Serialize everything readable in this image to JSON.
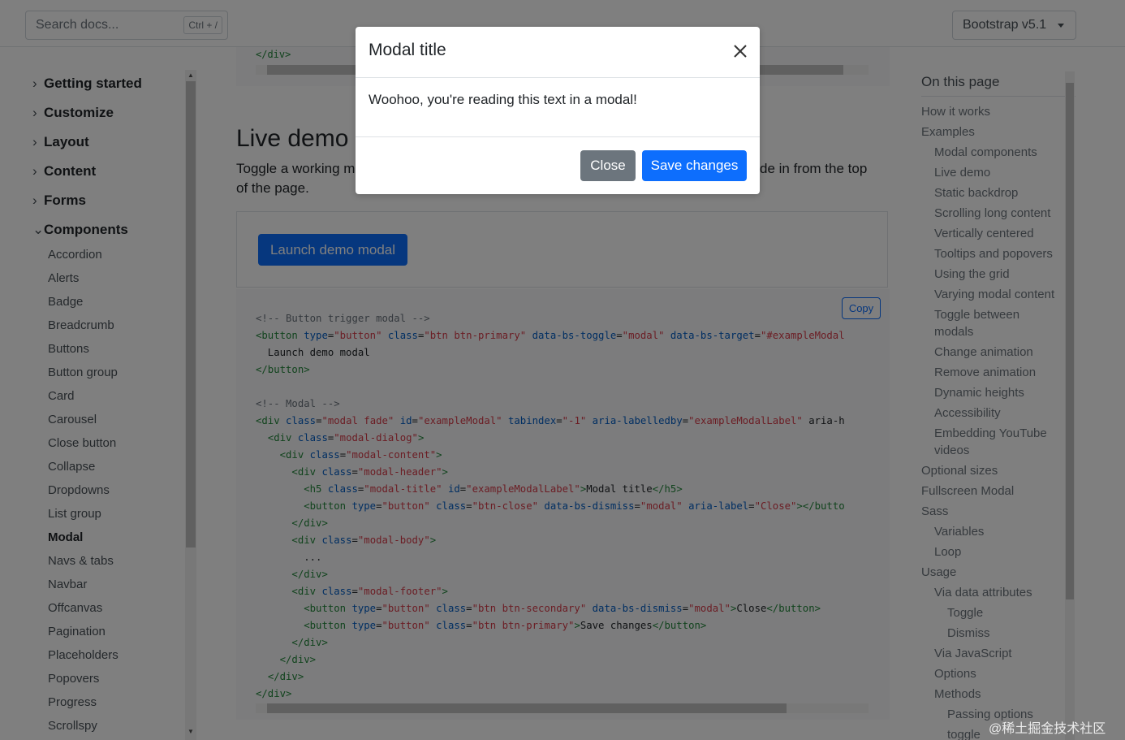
{
  "header": {
    "search_placeholder": "Search docs...",
    "search_shortcut": "Ctrl + /",
    "version_label": "Bootstrap v5.1"
  },
  "sidebar": {
    "sections": [
      {
        "label": "Getting started",
        "expanded": false
      },
      {
        "label": "Customize",
        "expanded": false
      },
      {
        "label": "Layout",
        "expanded": false
      },
      {
        "label": "Content",
        "expanded": false
      },
      {
        "label": "Forms",
        "expanded": false
      },
      {
        "label": "Components",
        "expanded": true
      }
    ],
    "items": [
      "Accordion",
      "Alerts",
      "Badge",
      "Breadcrumb",
      "Buttons",
      "Button group",
      "Card",
      "Carousel",
      "Close button",
      "Collapse",
      "Dropdowns",
      "List group",
      "Modal",
      "Navs & tabs",
      "Navbar",
      "Offcanvas",
      "Pagination",
      "Placeholders",
      "Popovers",
      "Progress",
      "Scrollspy"
    ],
    "active_item": "Modal"
  },
  "main": {
    "top_code_fragment": "</div>",
    "heading": "Live demo",
    "lead_left": "Toggle a working m",
    "lead_right": "de in from the top",
    "lead_line2": "of the page.",
    "launch_button": "Launch demo modal",
    "copy_button": "Copy",
    "code_lines": [
      "<!-- Button trigger modal -->",
      "<button type=\"button\" class=\"btn btn-primary\" data-bs-toggle=\"modal\" data-bs-target=\"#exampleModal",
      "  Launch demo modal",
      "</button>",
      "",
      "<!-- Modal -->",
      "<div class=\"modal fade\" id=\"exampleModal\" tabindex=\"-1\" aria-labelledby=\"exampleModalLabel\" aria-h",
      "  <div class=\"modal-dialog\">",
      "    <div class=\"modal-content\">",
      "      <div class=\"modal-header\">",
      "        <h5 class=\"modal-title\" id=\"exampleModalLabel\">Modal title</h5>",
      "        <button type=\"button\" class=\"btn-close\" data-bs-dismiss=\"modal\" aria-label=\"Close\"></butto",
      "      </div>",
      "      <div class=\"modal-body\">",
      "        ...",
      "      </div>",
      "      <div class=\"modal-footer\">",
      "        <button type=\"button\" class=\"btn btn-secondary\" data-bs-dismiss=\"modal\">Close</button>",
      "        <button type=\"button\" class=\"btn btn-primary\">Save changes</button>",
      "      </div>",
      "    </div>",
      "  </div>",
      "</div>"
    ]
  },
  "toc": {
    "title": "On this page",
    "items": [
      {
        "label": "How it works",
        "level": 0
      },
      {
        "label": "Examples",
        "level": 0
      },
      {
        "label": "Modal components",
        "level": 1
      },
      {
        "label": "Live demo",
        "level": 1
      },
      {
        "label": "Static backdrop",
        "level": 1
      },
      {
        "label": "Scrolling long content",
        "level": 1
      },
      {
        "label": "Vertically centered",
        "level": 1
      },
      {
        "label": "Tooltips and popovers",
        "level": 1
      },
      {
        "label": "Using the grid",
        "level": 1
      },
      {
        "label": "Varying modal content",
        "level": 1
      },
      {
        "label": "Toggle between\nmodals",
        "level": 1
      },
      {
        "label": "Change animation",
        "level": 1
      },
      {
        "label": "Remove animation",
        "level": 1
      },
      {
        "label": "Dynamic heights",
        "level": 1
      },
      {
        "label": "Accessibility",
        "level": 1
      },
      {
        "label": "Embedding YouTube\nvideos",
        "level": 1
      },
      {
        "label": "Optional sizes",
        "level": 0
      },
      {
        "label": "Fullscreen Modal",
        "level": 0
      },
      {
        "label": "Sass",
        "level": 0
      },
      {
        "label": "Variables",
        "level": 1
      },
      {
        "label": "Loop",
        "level": 1
      },
      {
        "label": "Usage",
        "level": 0
      },
      {
        "label": "Via data attributes",
        "level": 1
      },
      {
        "label": "Toggle",
        "level": 2
      },
      {
        "label": "Dismiss",
        "level": 2
      },
      {
        "label": "Via JavaScript",
        "level": 1
      },
      {
        "label": "Options",
        "level": 1
      },
      {
        "label": "Methods",
        "level": 1
      },
      {
        "label": "Passing options",
        "level": 2
      },
      {
        "label": "toggle",
        "level": 2
      }
    ]
  },
  "modal": {
    "title": "Modal title",
    "body": "Woohoo, you're reading this text in a modal!",
    "close_label": "Close",
    "save_label": "Save changes"
  },
  "watermark": "@稀土掘金技术社区",
  "colors": {
    "primary": "#0d6efd",
    "secondary": "#6c757d",
    "backdrop": "rgba(0,0,0,0.5)"
  }
}
